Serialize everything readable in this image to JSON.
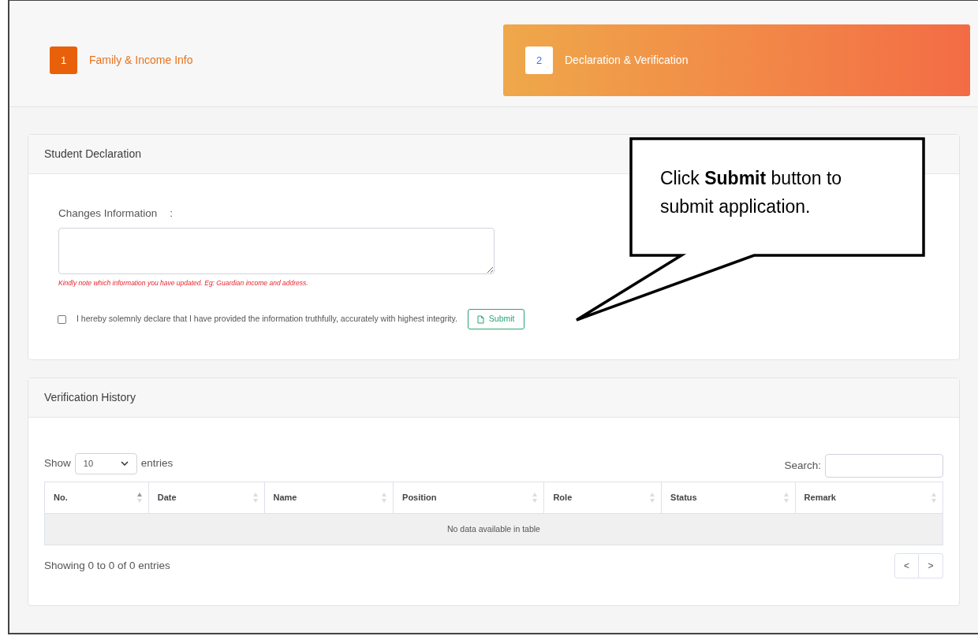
{
  "steps": [
    {
      "number": "1",
      "label": "Family & Income Info",
      "selected": false
    },
    {
      "number": "2",
      "label": "Declaration & Verification",
      "selected": true
    }
  ],
  "declaration": {
    "title": "Student Declaration",
    "field_label": "Changes Information",
    "separator": ":",
    "note": "Kindly note which information you have updated. Eg: Guardian income and address.",
    "checkbox_label": "I hereby solemnly declare that I have provided the information truthfully, accurately with highest integrity.",
    "checked": false,
    "submit": "Submit"
  },
  "callout": {
    "text": "Click **Submit** button to submit application."
  },
  "history": {
    "title": "Verification History",
    "show_label": "Show",
    "page_size": "10",
    "entries_label": "entries",
    "search_label": "Search:",
    "columns": [
      "No.",
      "Date",
      "Name",
      "Position",
      "Role",
      "Status",
      "Remark"
    ],
    "empty": "No data available in table",
    "info": "Showing 0 to 0 of 0 entries",
    "prev": "<",
    "next": ">"
  }
}
